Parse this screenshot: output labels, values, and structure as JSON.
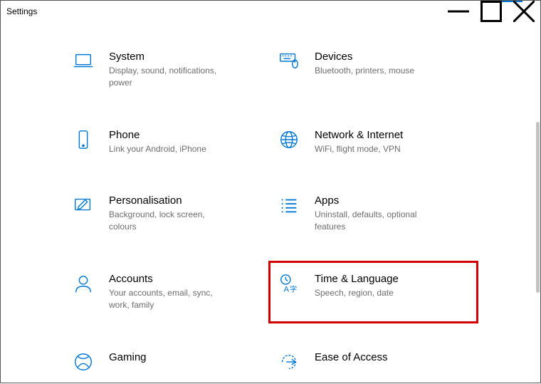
{
  "window": {
    "title": "Settings"
  },
  "categories": [
    {
      "id": "system",
      "title": "System",
      "desc": "Display, sound, notifications, power",
      "icon": "laptop-icon"
    },
    {
      "id": "devices",
      "title": "Devices",
      "desc": "Bluetooth, printers, mouse",
      "icon": "keyboard-icon"
    },
    {
      "id": "phone",
      "title": "Phone",
      "desc": "Link your Android, iPhone",
      "icon": "phone-icon"
    },
    {
      "id": "network",
      "title": "Network & Internet",
      "desc": "WiFi, flight mode, VPN",
      "icon": "globe-icon"
    },
    {
      "id": "personalisation",
      "title": "Personalisation",
      "desc": "Background, lock screen, colours",
      "icon": "pen-icon"
    },
    {
      "id": "apps",
      "title": "Apps",
      "desc": "Uninstall, defaults, optional features",
      "icon": "list-icon"
    },
    {
      "id": "accounts",
      "title": "Accounts",
      "desc": "Your accounts, email, sync, work, family",
      "icon": "person-icon"
    },
    {
      "id": "time",
      "title": "Time & Language",
      "desc": "Speech, region, date",
      "icon": "clock-lang-icon",
      "highlighted": true
    },
    {
      "id": "gaming",
      "title": "Gaming",
      "desc": "",
      "icon": "xbox-icon"
    },
    {
      "id": "ease",
      "title": "Ease of Access",
      "desc": "",
      "icon": "ease-icon"
    }
  ],
  "colors": {
    "accent": "#0078d4",
    "highlight": "#d40000"
  }
}
